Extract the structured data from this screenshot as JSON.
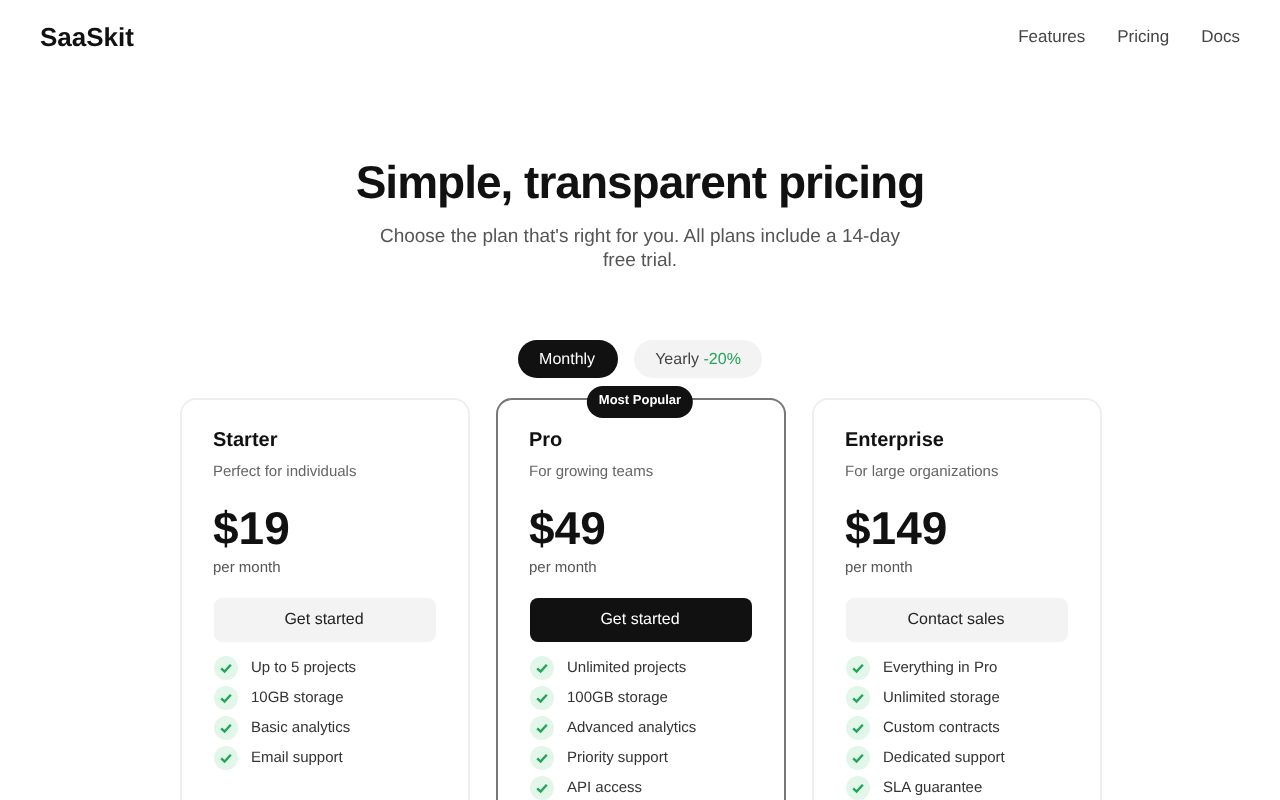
{
  "header": {
    "logo": "SaaSkit",
    "nav": [
      "Features",
      "Pricing",
      "Docs"
    ]
  },
  "hero": {
    "title": "Simple, transparent pricing",
    "subtitle": "Choose the plan that's right for you. All plans include a 14-day free trial."
  },
  "billing_toggle": [
    {
      "label": "Monthly",
      "selected": true
    },
    {
      "label": "Yearly",
      "discount": "-20%",
      "selected": false
    }
  ],
  "plans": [
    {
      "name": "Starter",
      "description": "Perfect for individuals",
      "price": "$19",
      "period": "per month",
      "featured": false,
      "button": {
        "label": "Get started",
        "kind": "secondary"
      },
      "features": [
        "Up to 5 projects",
        "10GB storage",
        "Basic analytics",
        "Email support"
      ]
    },
    {
      "name": "Pro",
      "badge": "Most Popular",
      "description": "For growing teams",
      "price": "$49",
      "period": "per month",
      "featured": true,
      "button": {
        "label": "Get started",
        "kind": "primary"
      },
      "features": [
        "Unlimited projects",
        "100GB storage",
        "Advanced analytics",
        "Priority support",
        "API access"
      ]
    },
    {
      "name": "Enterprise",
      "description": "For large organizations",
      "price": "$149",
      "period": "per month",
      "featured": false,
      "button": {
        "label": "Contact sales",
        "kind": "secondary"
      },
      "features": [
        "Everything in Pro",
        "Unlimited storage",
        "Custom contracts",
        "Dedicated support",
        "SLA guarantee"
      ]
    }
  ]
}
